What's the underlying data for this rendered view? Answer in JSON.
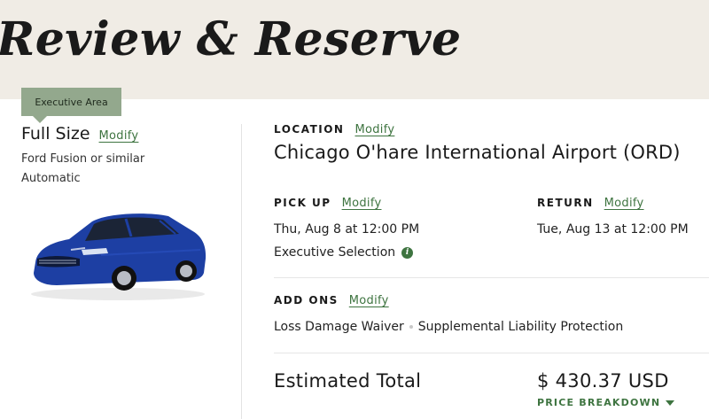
{
  "header": {
    "title": "Review & Reserve"
  },
  "vehicle": {
    "area_tag": "Executive Area",
    "class_name": "Full Size",
    "modify_label": "Modify",
    "model": "Ford Fusion or similar",
    "transmission": "Automatic",
    "image_icon": "car-image",
    "car_color": "#1d3fa3"
  },
  "location": {
    "label": "LOCATION",
    "modify_label": "Modify",
    "value": "Chicago O'hare International Airport (ORD)"
  },
  "pickup": {
    "label": "PICK UP",
    "modify_label": "Modify",
    "datetime": "Thu, Aug 8 at 12:00 PM",
    "selection": "Executive Selection",
    "info_icon": "info-icon"
  },
  "return": {
    "label": "RETURN",
    "modify_label": "Modify",
    "datetime": "Tue, Aug 13 at 12:00 PM"
  },
  "addons": {
    "label": "ADD ONS",
    "modify_label": "Modify",
    "items": [
      "Loss Damage Waiver",
      "Supplemental Liability Protection"
    ]
  },
  "total": {
    "label": "Estimated Total",
    "value": "$ 430.37 USD",
    "breakdown_label": "PRICE BREAKDOWN"
  },
  "colors": {
    "accent": "#3e7440",
    "hero_bg": "#f0ece5",
    "tag_bg": "#93a88d"
  }
}
